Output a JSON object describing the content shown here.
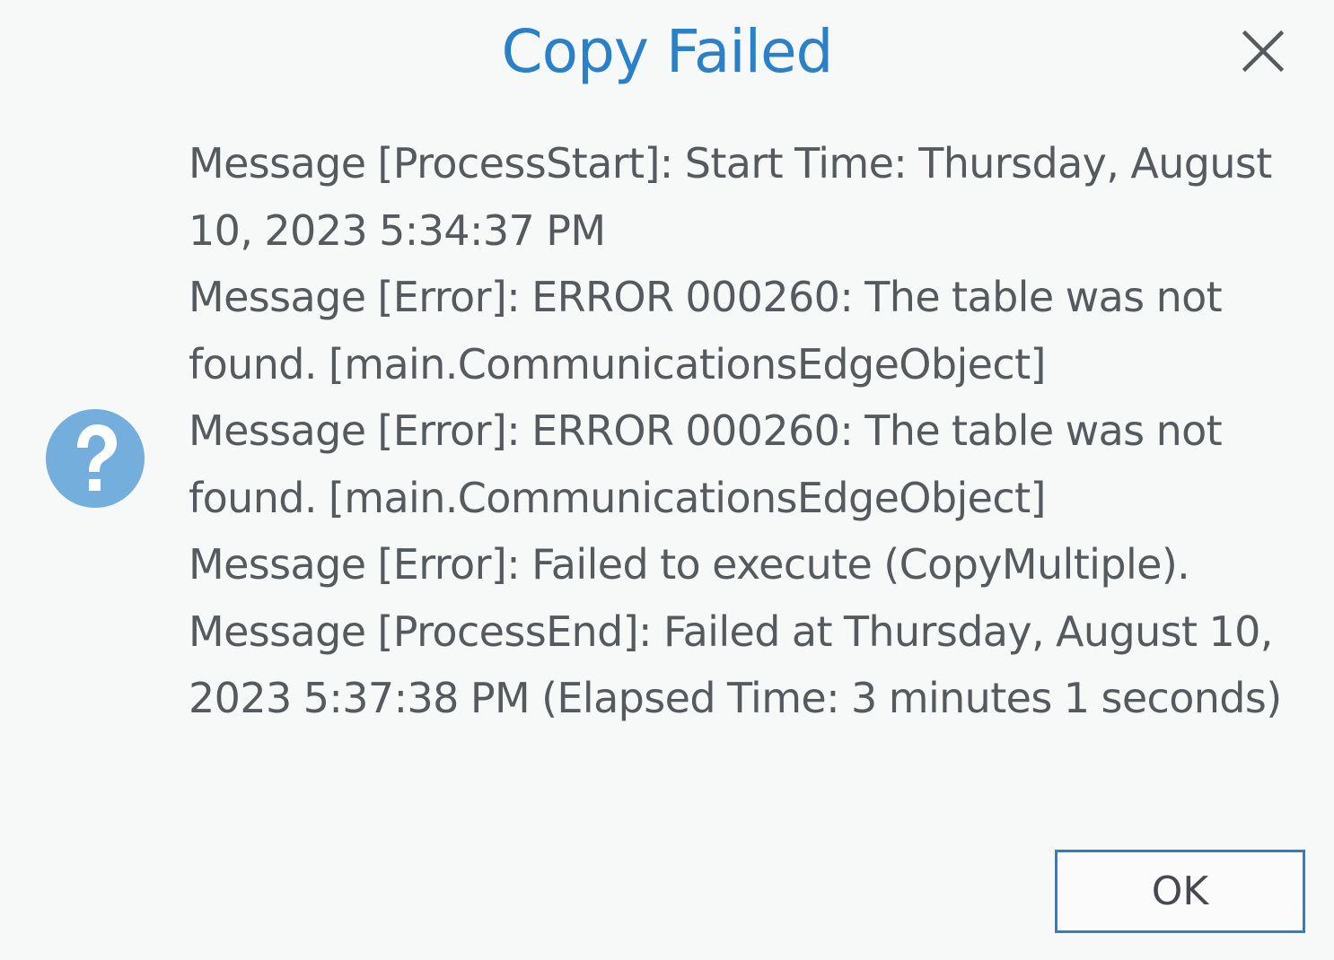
{
  "dialog": {
    "title": "Copy Failed",
    "ok_label": "OK",
    "messages": [
      "Message [ProcessStart]: Start Time: Thursday, August 10, 2023 5:34:37 PM",
      "Message [Error]: ERROR 000260: The table was not found. [main.CommunicationsEdgeObject]",
      "Message [Error]: ERROR 000260: The table was not found. [main.CommunicationsEdgeObject]",
      "Message [Error]: Failed to execute (CopyMultiple).",
      "Message [ProcessEnd]: Failed at Thursday, August 10, 2023 5:37:38 PM (Elapsed Time: 3 minutes 1 seconds)"
    ]
  },
  "icons": {
    "question": "question-icon",
    "close": "close-icon"
  },
  "colors": {
    "accent": "#2a80c9",
    "icon_fill": "#74aedd",
    "text": "#555a5f",
    "background": "#f7f8f8"
  }
}
